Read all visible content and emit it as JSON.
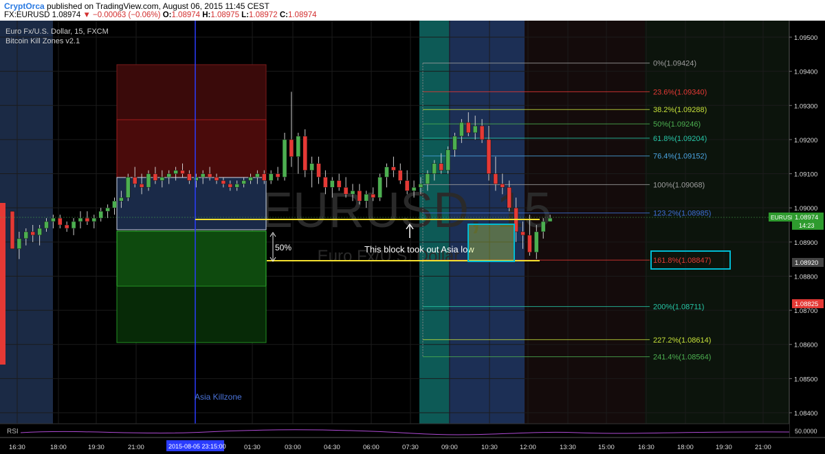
{
  "header": {
    "author": "CryptOrca",
    "published": "published on TradingView.com, August 06, 2015 11:45 CEST",
    "symbol": "FX:EURUSD",
    "last": "1.08974",
    "change": "▼ −0.00063 (−0.06%)",
    "o_label": "O:",
    "o": "1.08974",
    "h_label": "H:",
    "h": "1.08975",
    "l_label": "L:",
    "l": "1.08972",
    "c_label": "C:",
    "c": "1.08974"
  },
  "legend": {
    "symbol_line": "Euro Fx/U.S. Dollar, 15, FXCM",
    "indicator_line": "Bitcoin Kill Zones v2.1"
  },
  "watermark": {
    "big": "EURUSD, 15",
    "small": "Euro Fx/U.S. Dollar"
  },
  "rsi": {
    "label": "RSI",
    "value_label": "50.0000"
  },
  "colors": {
    "bull": "#4caf50",
    "bear": "#e53935",
    "fib_box": "#00bcd4",
    "asia_line": "#2a3cff",
    "yellow": "#f5e12f"
  },
  "chart_data": {
    "type": "candlestick",
    "y_axis": {
      "min": 1.0838,
      "max": 1.097,
      "ticks": [
        "1.09500",
        "1.09400",
        "1.09300",
        "1.09200",
        "1.09100",
        "1.09000",
        "1.08900",
        "1.08800",
        "1.08700",
        "1.08600",
        "1.08500",
        "1.08400"
      ]
    },
    "x_ticks": [
      "16:30",
      "18:00",
      "19:30",
      "21:00",
      "01:30",
      "03:00",
      "04:30",
      "06:00",
      "07:30",
      "09:00",
      "10:30",
      "12:00",
      "13:30",
      "15:00",
      "16:30",
      "18:00",
      "19:30",
      "21:00"
    ],
    "x_cursor_label": "2015-08-05 23:15:00",
    "price_labels": [
      {
        "text": "EURUSD",
        "value": "1.08974"
      },
      {
        "text": "14:23"
      },
      {
        "value": "1.08920"
      },
      {
        "value": "1.08825"
      }
    ],
    "fib_levels": [
      {
        "label": "0%(1.09424)",
        "price": 1.09424,
        "color": "#9e9e9e"
      },
      {
        "label": "23.6%(1.09340)",
        "price": 1.0934,
        "color": "#e53935"
      },
      {
        "label": "38.2%(1.09288)",
        "price": 1.09288,
        "color": "#c6e03a"
      },
      {
        "label": "50%(1.09246)",
        "price": 1.09246,
        "color": "#4caf50"
      },
      {
        "label": "61.8%(1.09204)",
        "price": 1.09204,
        "color": "#26c6a6"
      },
      {
        "label": "76.4%(1.09152)",
        "price": 1.09152,
        "color": "#4aa3df"
      },
      {
        "label": "100%(1.09068)",
        "price": 1.09068,
        "color": "#9e9e9e"
      },
      {
        "label": "123.2%(1.08985)",
        "price": 1.08985,
        "color": "#3f6fd6"
      },
      {
        "label": "161.8%(1.08847)",
        "price": 1.08847,
        "color": "#e53935"
      },
      {
        "label": "200%(1.08711)",
        "price": 1.08711,
        "color": "#26c6a6"
      },
      {
        "label": "227.2%(1.08614)",
        "price": 1.08614,
        "color": "#c6e03a"
      },
      {
        "label": "241.4%(1.08564)",
        "price": 1.08564,
        "color": "#4caf50"
      }
    ],
    "annotations": [
      {
        "text": "50%"
      },
      {
        "text": "This block took out Asia low"
      },
      {
        "text": "Asia Killzone"
      }
    ],
    "candles": [
      [
        1.0899,
        1.0899,
        1.0888,
        1.0888
      ],
      [
        1.0888,
        1.0893,
        1.0885,
        1.0891
      ],
      [
        1.0891,
        1.0894,
        1.0889,
        1.0893
      ],
      [
        1.0893,
        1.0895,
        1.089,
        1.0892
      ],
      [
        1.0892,
        1.0895,
        1.0889,
        1.0894
      ],
      [
        1.0894,
        1.0897,
        1.0893,
        1.0896
      ],
      [
        1.0896,
        1.0898,
        1.0894,
        1.0897
      ],
      [
        1.0897,
        1.0898,
        1.0894,
        1.0895
      ],
      [
        1.0895,
        1.0896,
        1.0893,
        1.0894
      ],
      [
        1.0894,
        1.0897,
        1.0892,
        1.0896
      ],
      [
        1.0896,
        1.0899,
        1.0894,
        1.0897
      ],
      [
        1.0897,
        1.0899,
        1.0895,
        1.0896
      ],
      [
        1.0896,
        1.0898,
        1.0894,
        1.0897
      ],
      [
        1.0897,
        1.09,
        1.0896,
        1.0899
      ],
      [
        1.0899,
        1.0901,
        1.0897,
        1.09
      ],
      [
        1.09,
        1.0903,
        1.0898,
        1.0902
      ],
      [
        1.0902,
        1.0905,
        1.09,
        1.0903
      ],
      [
        1.0903,
        1.091,
        1.0902,
        1.0909
      ],
      [
        1.0909,
        1.0912,
        1.0906,
        1.0907
      ],
      [
        1.0907,
        1.091,
        1.0904,
        1.0906
      ],
      [
        1.0906,
        1.0911,
        1.0905,
        1.091
      ],
      [
        1.091,
        1.0912,
        1.0907,
        1.0908
      ],
      [
        1.0908,
        1.0911,
        1.0906,
        1.0909
      ],
      [
        1.0909,
        1.0911,
        1.0907,
        1.091
      ],
      [
        1.091,
        1.0912,
        1.0908,
        1.0911
      ],
      [
        1.0911,
        1.0913,
        1.0909,
        1.091
      ],
      [
        1.091,
        1.0911,
        1.0907,
        1.0908
      ],
      [
        1.0908,
        1.091,
        1.0906,
        1.0909
      ],
      [
        1.0909,
        1.0911,
        1.0907,
        1.091
      ],
      [
        1.091,
        1.0912,
        1.0908,
        1.0909
      ],
      [
        1.0909,
        1.091,
        1.0907,
        1.0908
      ],
      [
        1.0908,
        1.0909,
        1.0906,
        1.0907
      ],
      [
        1.0907,
        1.0908,
        1.0905,
        1.0906
      ],
      [
        1.0906,
        1.0908,
        1.0905,
        1.0907
      ],
      [
        1.0907,
        1.0909,
        1.0906,
        1.0908
      ],
      [
        1.0908,
        1.091,
        1.0907,
        1.0909
      ],
      [
        1.0909,
        1.0911,
        1.0907,
        1.091
      ],
      [
        1.091,
        1.0911,
        1.0907,
        1.0908
      ],
      [
        1.0908,
        1.0911,
        1.0907,
        1.091
      ],
      [
        1.091,
        1.0912,
        1.0908,
        1.0909
      ],
      [
        1.0909,
        1.0922,
        1.0908,
        1.092
      ],
      [
        1.092,
        1.0934,
        1.0912,
        1.0915
      ],
      [
        1.0915,
        1.0922,
        1.091,
        1.0921
      ],
      [
        1.0921,
        1.0923,
        1.0909,
        1.0911
      ],
      [
        1.0911,
        1.0915,
        1.0906,
        1.0913
      ],
      [
        1.0913,
        1.0915,
        1.0907,
        1.0909
      ],
      [
        1.0909,
        1.0911,
        1.0904,
        1.0906
      ],
      [
        1.0906,
        1.0909,
        1.0903,
        1.0908
      ],
      [
        1.0908,
        1.091,
        1.0905,
        1.0906
      ],
      [
        1.0906,
        1.0909,
        1.0903,
        1.0904
      ],
      [
        1.0904,
        1.0907,
        1.0902,
        1.0905
      ],
      [
        1.0905,
        1.0907,
        1.0901,
        1.0902
      ],
      [
        1.0902,
        1.0905,
        1.09,
        1.0904
      ],
      [
        1.0904,
        1.0906,
        1.0902,
        1.0903
      ],
      [
        1.0903,
        1.091,
        1.0902,
        1.0909
      ],
      [
        1.0909,
        1.0913,
        1.0906,
        1.0912
      ],
      [
        1.0912,
        1.0915,
        1.0909,
        1.0911
      ],
      [
        1.0911,
        1.0913,
        1.0907,
        1.0908
      ],
      [
        1.0908,
        1.0911,
        1.0904,
        1.0905
      ],
      [
        1.0905,
        1.0908,
        1.0903,
        1.0906
      ],
      [
        1.0906,
        1.0909,
        1.0904,
        1.0907
      ],
      [
        1.0907,
        1.0911,
        1.0905,
        1.091
      ],
      [
        1.091,
        1.0914,
        1.0908,
        1.0913
      ],
      [
        1.0913,
        1.0916,
        1.091,
        1.0911
      ],
      [
        1.0911,
        1.0918,
        1.091,
        1.0917
      ],
      [
        1.0917,
        1.0922,
        1.0915,
        1.0921
      ],
      [
        1.0921,
        1.0926,
        1.0919,
        1.0925
      ],
      [
        1.0925,
        1.0928,
        1.0921,
        1.0922
      ],
      [
        1.0922,
        1.0927,
        1.092,
        1.0924
      ],
      [
        1.0924,
        1.0926,
        1.0919,
        1.092
      ],
      [
        1.092,
        1.0924,
        1.0908,
        1.091
      ],
      [
        1.091,
        1.0915,
        1.0905,
        1.0907
      ],
      [
        1.0907,
        1.091,
        1.0904,
        1.0906
      ],
      [
        1.0906,
        1.0908,
        1.0899,
        1.09
      ],
      [
        1.09,
        1.0903,
        1.089,
        1.0893
      ],
      [
        1.0893,
        1.0896,
        1.0888,
        1.0892
      ],
      [
        1.0892,
        1.0898,
        1.0886,
        1.0887
      ],
      [
        1.0887,
        1.0895,
        1.0885,
        1.0893
      ],
      [
        1.0893,
        1.0897,
        1.0891,
        1.0896
      ],
      [
        1.0896,
        1.0898,
        1.0896,
        1.0897
      ]
    ]
  }
}
